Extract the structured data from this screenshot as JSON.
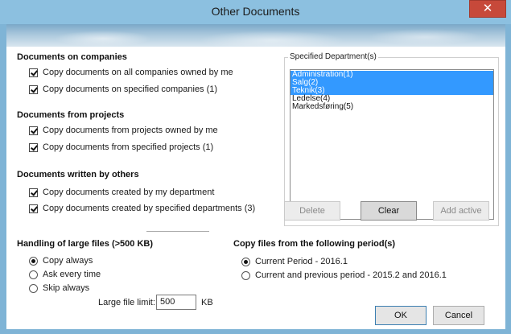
{
  "window": {
    "title": "Other Documents",
    "close_glyph": "✕"
  },
  "companies": {
    "heading": "Documents on companies",
    "items": [
      {
        "label": "Copy documents on all companies owned by me",
        "checked": true
      },
      {
        "label": "Copy documents on specified companies (1)",
        "checked": true
      }
    ]
  },
  "projects": {
    "heading": "Documents from projects",
    "items": [
      {
        "label": "Copy documents from projects owned by me",
        "checked": true
      },
      {
        "label": "Copy documents from specified projects (1)",
        "checked": true
      }
    ]
  },
  "others": {
    "heading": "Documents written by others",
    "items": [
      {
        "label": "Copy documents created by my department",
        "checked": true
      },
      {
        "label": "Copy documents created by specified departments (3)",
        "checked": true
      }
    ]
  },
  "departments": {
    "group_label": "Specified Department(s)",
    "items": [
      {
        "label": "Administration(1)",
        "selected": true
      },
      {
        "label": "Salg(2)",
        "selected": true
      },
      {
        "label": "Teknik(3)",
        "selected": true
      },
      {
        "label": "Ledelse(4)",
        "selected": false
      },
      {
        "label": "Markedsføring(5)",
        "selected": false
      }
    ],
    "delete_label": "Delete",
    "clear_label": "Clear",
    "add_active_label": "Add active"
  },
  "large_files": {
    "heading": "Handling of large files (>500 KB)",
    "options": [
      {
        "label": "Copy always",
        "checked": true
      },
      {
        "label": "Ask every time",
        "checked": false
      },
      {
        "label": "Skip always",
        "checked": false
      }
    ],
    "limit_label": "Large file limit:",
    "limit_value": "500",
    "limit_unit": "KB"
  },
  "period": {
    "heading": "Copy files from the following period(s)",
    "options": [
      {
        "label": "Current Period - 2016.1",
        "checked": true
      },
      {
        "label": "Current and previous period - 2015.2 and 2016.1",
        "checked": false
      }
    ]
  },
  "footer": {
    "ok_label": "OK",
    "cancel_label": "Cancel"
  },
  "colors": {
    "selection": "#3399ff",
    "close_button": "#c7493a"
  }
}
